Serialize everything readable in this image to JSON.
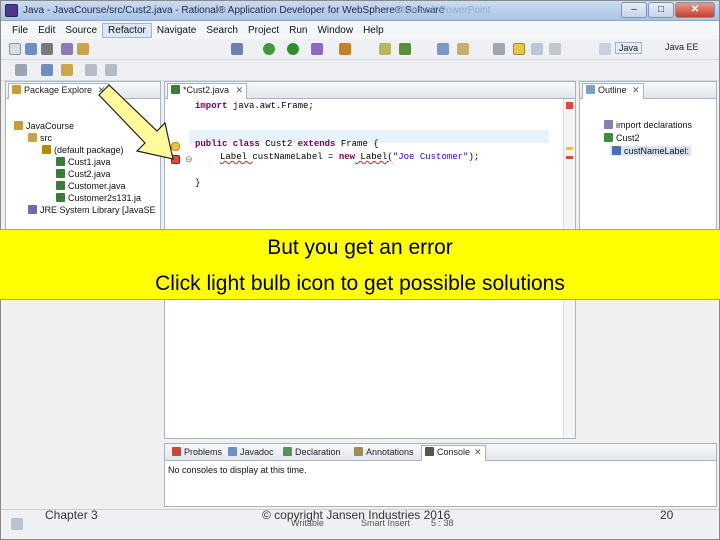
{
  "window": {
    "title": "Java - JavaCourse/src/Cust2.java - Rational® Application Developer for WebSphere® Software",
    "ghost_title": "Microsoft PowerPoint",
    "controls": {
      "minimize": "–",
      "maximize": "□",
      "close": "✕"
    }
  },
  "menu": {
    "items": [
      "File",
      "Edit",
      "Source",
      "Refactor",
      "Navigate",
      "Search",
      "Project",
      "Run",
      "Window",
      "Help"
    ],
    "active_index": 3
  },
  "perspectives": {
    "java": "Java",
    "java_ee": "Java EE"
  },
  "package_explorer": {
    "tab_label": "Package Explore",
    "tab_close": "✕",
    "tree": [
      {
        "label": "JavaCourse",
        "depth": 0
      },
      {
        "label": "src",
        "depth": 1
      },
      {
        "label": "(default package)",
        "depth": 2
      },
      {
        "label": "Cust1.java",
        "depth": 3
      },
      {
        "label": "Cust2.java",
        "depth": 3
      },
      {
        "label": "Customer.java",
        "depth": 3
      },
      {
        "label": "Customer2s131.ja",
        "depth": 3
      },
      {
        "label": "JRE System Library [JavaSE",
        "depth": 1
      }
    ]
  },
  "editor": {
    "tab_label": "*Cust2.java",
    "tab_close": "✕",
    "lines": {
      "l1_kw": "import",
      "l1_rest": " java.awt.Frame;",
      "l2_kw1": "public class",
      "l2_mid": " Cust2 ",
      "l2_kw2": "extends",
      "l2_rest": " Frame {",
      "l3_type": "Label ",
      "l3_var": "custNameLabel",
      "l3_mid": " = ",
      "l3_kw": "new",
      "l3_ctor": " Label(",
      "l3_str": "\"Joe Customer\"",
      "l3_end": ");",
      "l4": "}"
    }
  },
  "outline": {
    "tab_label": "Outline",
    "tab_close": "✕",
    "items": [
      "import declarations",
      "Cust2",
      "custNameLabel:"
    ]
  },
  "callout": {
    "line1": "But you get an error",
    "line2": "Click light bulb icon to get possible solutions"
  },
  "bottom_panel": {
    "tabs": [
      "Problems",
      "Javadoc",
      "Declaration",
      "Annotations",
      "Console"
    ],
    "tab_close": "✕",
    "message": "No consoles to display at this time."
  },
  "status": {
    "writable": "Writable",
    "insert_mode": "Smart Insert",
    "position": "5 : 38"
  },
  "slide_footer": {
    "left": "Chapter 3",
    "center": "© copyright Jansen Industries 2016",
    "page": "20"
  },
  "colors": {
    "callout": "#ffff00",
    "arrow_fill": "#fffb9c",
    "keyword": "#7f0055",
    "string": "#2a00ff"
  }
}
